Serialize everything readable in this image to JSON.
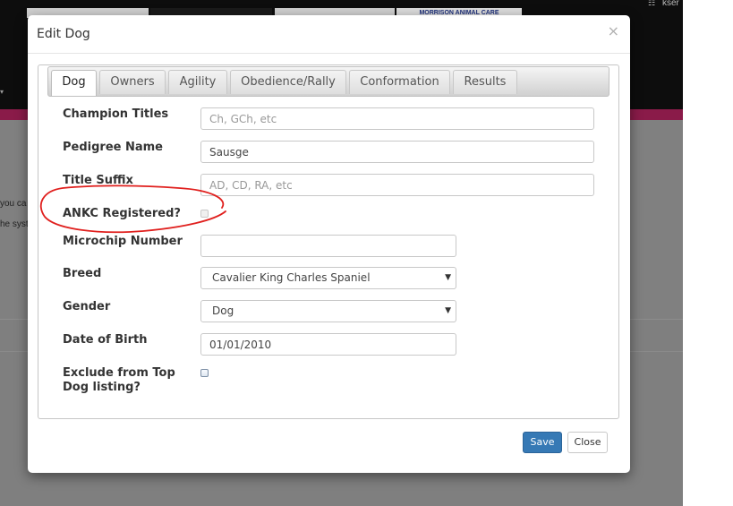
{
  "background": {
    "banner_text": "MORRISON ANIMAL CARE",
    "user_text": "kser",
    "text_line1": "you ca",
    "text_line2": "he syst"
  },
  "modal": {
    "title": "Edit Dog",
    "close_symbol": "×",
    "tabs": [
      {
        "label": "Dog",
        "active": true
      },
      {
        "label": "Owners",
        "active": false
      },
      {
        "label": "Agility",
        "active": false
      },
      {
        "label": "Obedience/Rally",
        "active": false
      },
      {
        "label": "Conformation",
        "active": false
      },
      {
        "label": "Results",
        "active": false
      }
    ],
    "fields": {
      "champion_titles": {
        "label": "Champion Titles",
        "value": "",
        "placeholder": "Ch, GCh, etc"
      },
      "pedigree_name": {
        "label": "Pedigree Name",
        "value": "Sausge",
        "placeholder": ""
      },
      "title_suffix": {
        "label": "Title Suffix",
        "value": "",
        "placeholder": "AD, CD, RA, etc"
      },
      "ankc_registered": {
        "label": "ANKC Registered?",
        "checked": false
      },
      "microchip_number": {
        "label": "Microchip Number",
        "value": ""
      },
      "breed": {
        "label": "Breed",
        "value": "Cavalier King Charles Spaniel"
      },
      "gender": {
        "label": "Gender",
        "value": "Dog"
      },
      "date_of_birth": {
        "label": "Date of Birth",
        "value": "01/01/2010"
      },
      "exclude_top_dog": {
        "label_line1": "Exclude from Top",
        "label_line2": "Dog listing?",
        "checked": false
      }
    },
    "buttons": {
      "save": "Save",
      "close": "Close"
    }
  },
  "colors": {
    "primary": "#3679b5",
    "annotation": "#e0201e",
    "pink_bar": "#8a1b49"
  }
}
